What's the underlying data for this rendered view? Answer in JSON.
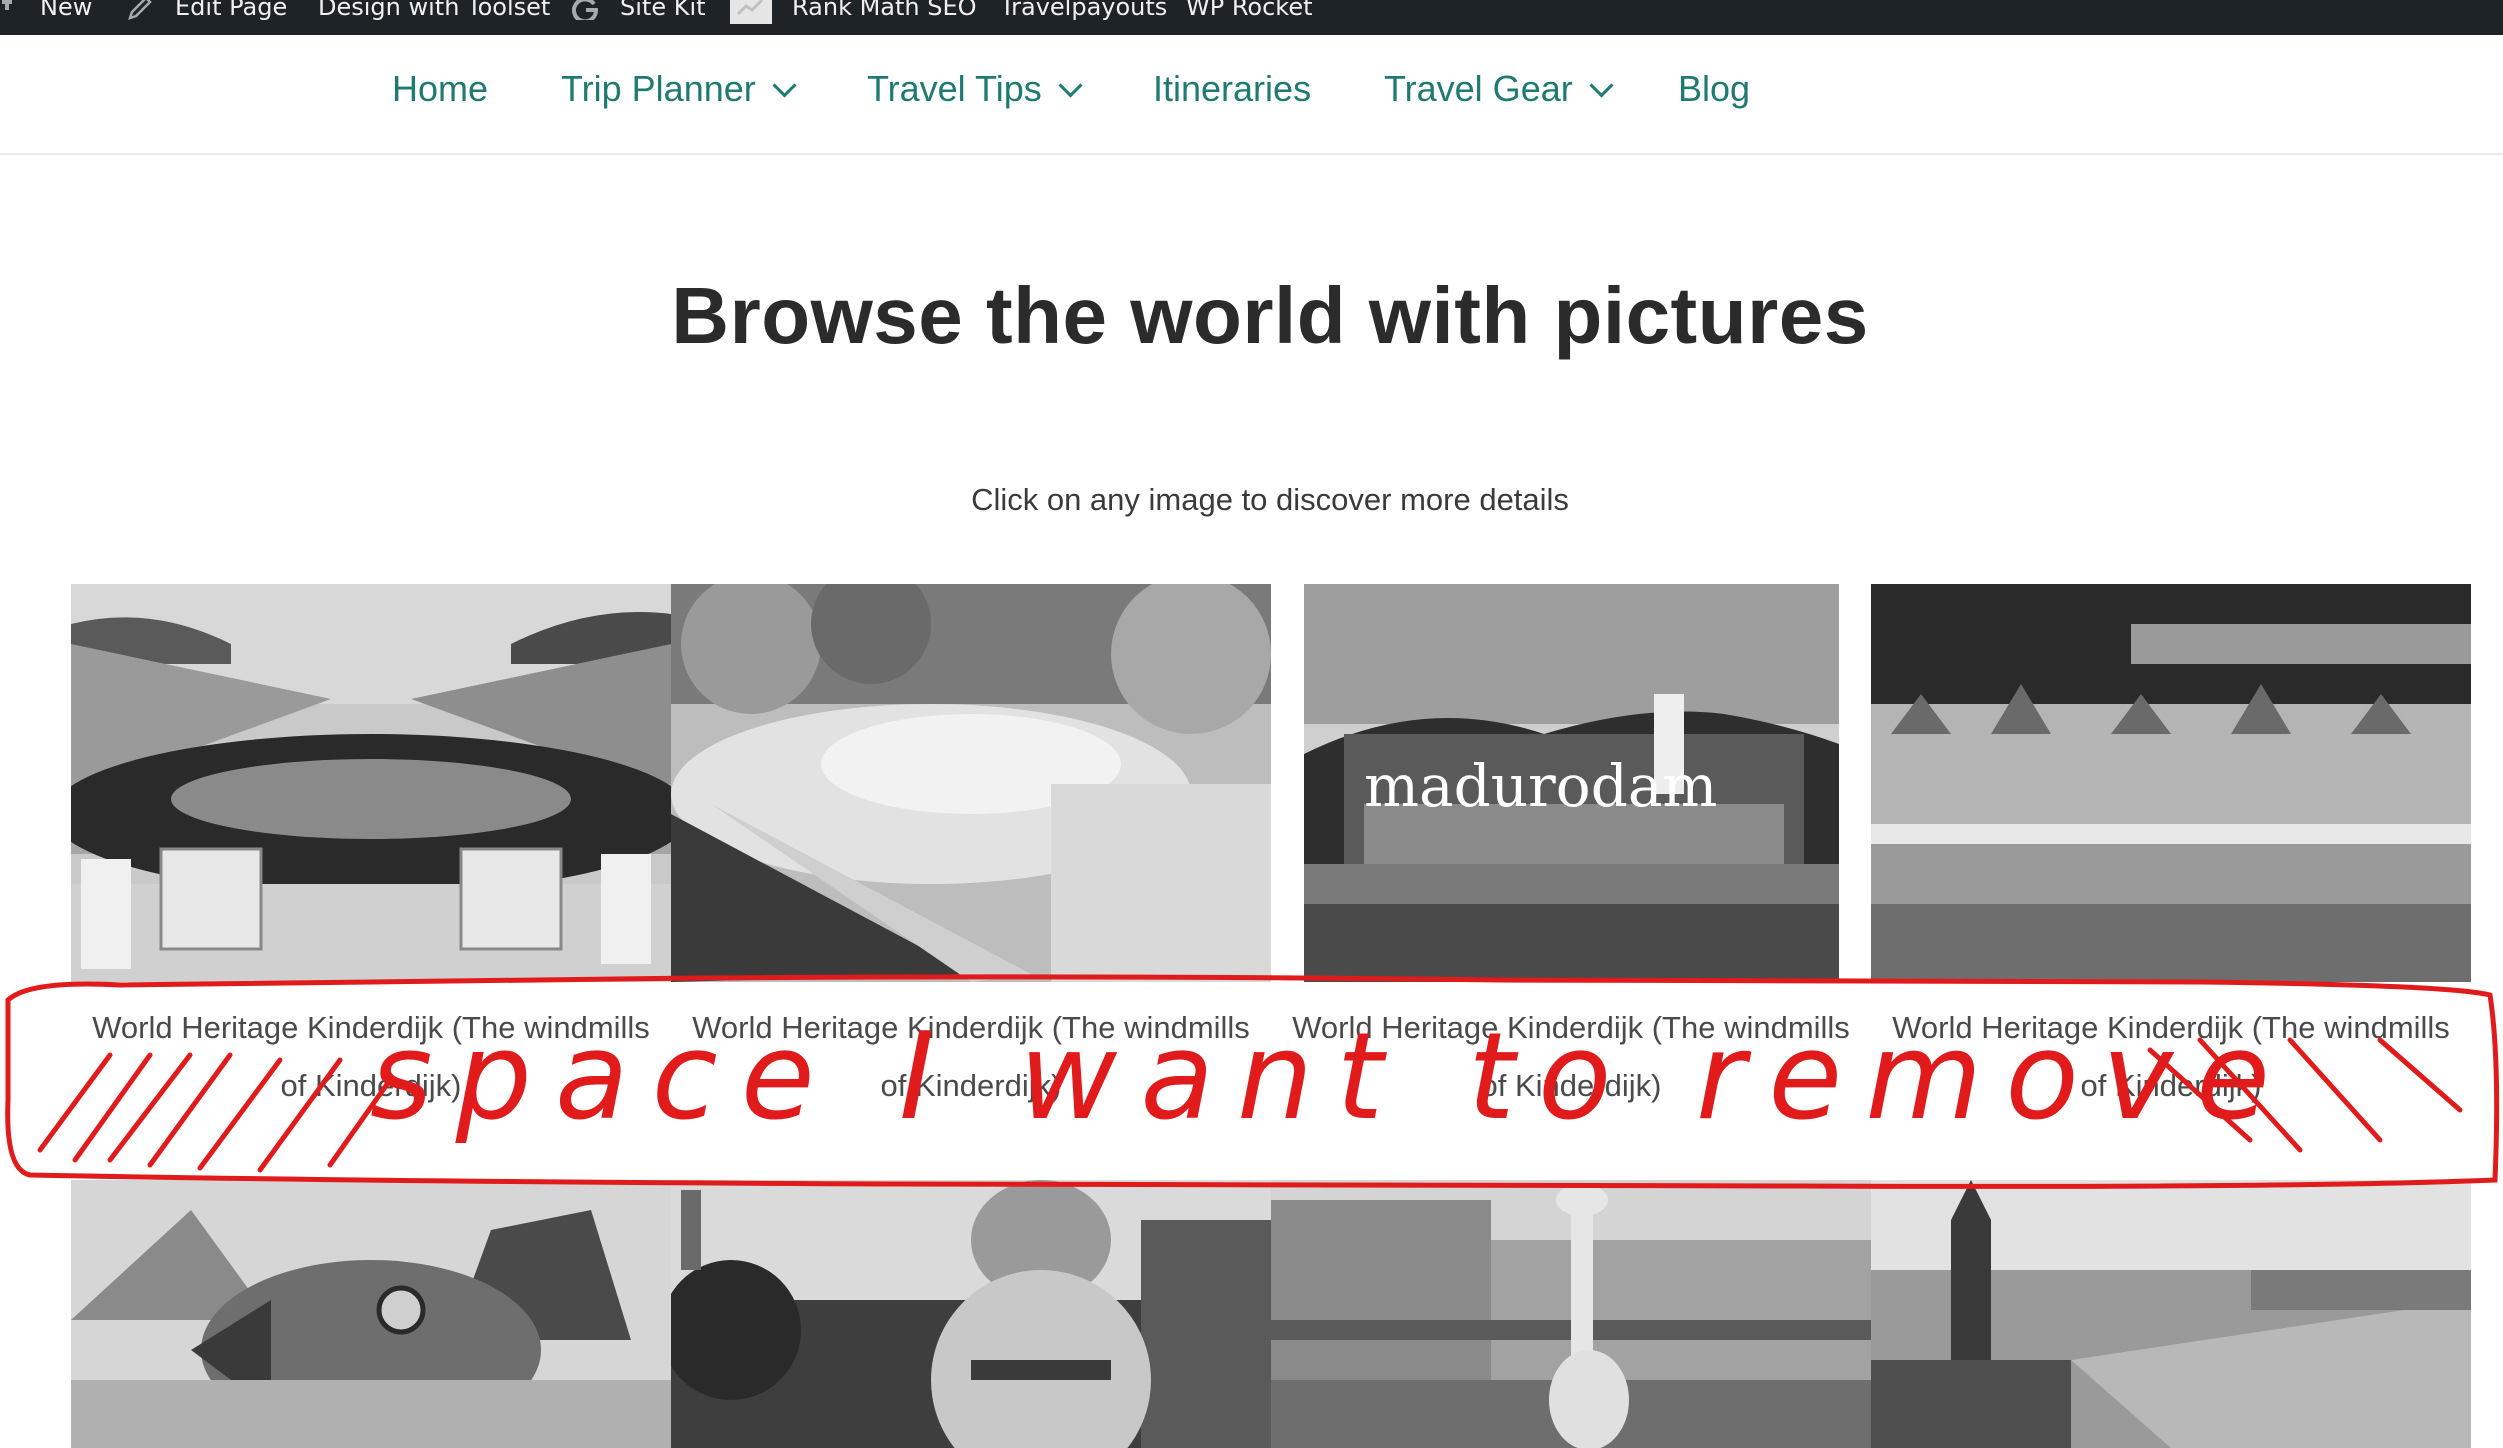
{
  "admin_bar": {
    "items": [
      {
        "label": "New",
        "icon": "plus-icon"
      },
      {
        "label": "Edit Page",
        "icon": "pencil-icon"
      },
      {
        "label": "Design with Toolset",
        "icon": ""
      },
      {
        "label": "Site Kit",
        "icon": "google-g-icon"
      },
      {
        "label": "Rank Math SEO",
        "icon": "rank-math-icon"
      },
      {
        "label": "Travelpayouts",
        "icon": ""
      },
      {
        "label": "WP Rocket",
        "icon": ""
      }
    ]
  },
  "nav": {
    "items": [
      {
        "label": "Home",
        "has_dropdown": false
      },
      {
        "label": "Trip Planner",
        "has_dropdown": true
      },
      {
        "label": "Travel Tips",
        "has_dropdown": true
      },
      {
        "label": "Itineraries",
        "has_dropdown": false
      },
      {
        "label": "Travel Gear",
        "has_dropdown": true
      },
      {
        "label": "Blog",
        "has_dropdown": false
      }
    ],
    "color": "#1f7a72"
  },
  "hero": {
    "title": "Browse the world with pictures",
    "subtitle": "Click on any image to discover more details"
  },
  "gallery": {
    "row1": [
      {
        "image": "stadium-photo",
        "caption_line1": "World Heritage Kinderdijk (The windmills",
        "caption_line2": "of Kinderdijk)"
      },
      {
        "image": "garden-canal-photo",
        "caption_line1": "World Heritage Kinderdijk (The windmills",
        "caption_line2": "of Kinderdijk)"
      },
      {
        "image": "madurodam-photo",
        "caption_line1": "World Heritage Kinderdijk (The windmills",
        "caption_line2": "of Kinderdijk)",
        "sign_text": "madurodam"
      },
      {
        "image": "seaside-villas-photo",
        "caption_line1": "World Heritage Kinderdijk (The windmills",
        "caption_line2": "of Kinderdijk)"
      }
    ],
    "row2": [
      {
        "image": "fish-sculpture-building-photo"
      },
      {
        "image": "inflatable-figure-photo"
      },
      {
        "image": "giraffe-sculpture-building-photo"
      },
      {
        "image": "harbor-city-aerial-photo"
      }
    ]
  },
  "annotation": {
    "text": "space I want to remove",
    "color": "#e11b1b"
  }
}
